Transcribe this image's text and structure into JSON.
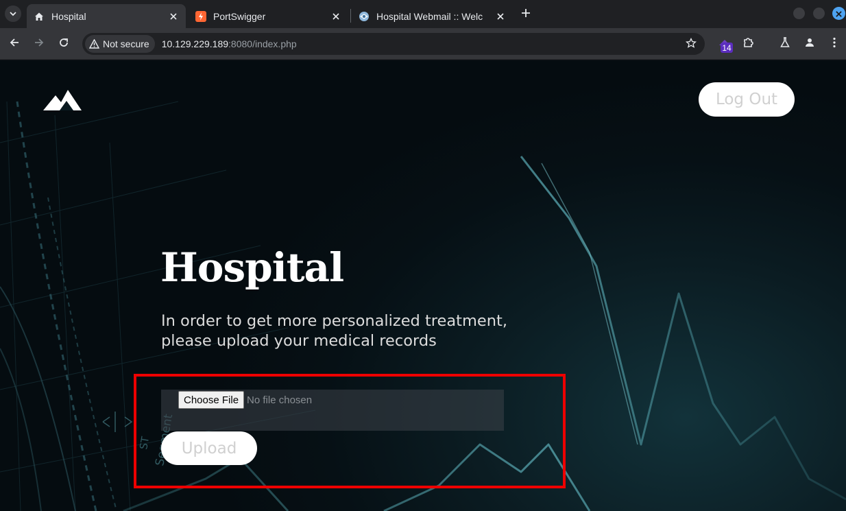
{
  "browser": {
    "tabs": [
      {
        "title": "Hospital",
        "favicon": "house-icon",
        "active": true
      },
      {
        "title": "PortSwigger",
        "favicon": "portswigger-icon",
        "active": false
      },
      {
        "title": "Hospital Webmail :: Welc",
        "favicon": "roundcube-icon",
        "active": false
      }
    ],
    "security_label": "Not secure",
    "url_host": "10.129.229.189",
    "url_rest": ":8080/index.php",
    "extension_badge": "14"
  },
  "page": {
    "logout_label": "Log Out",
    "title": "Hospital",
    "subtitle_line1": "In order to get more personalized treatment,",
    "subtitle_line2": "please upload your medical records",
    "file_input": {
      "button_label": "Choose File",
      "status": "No file chosen"
    },
    "upload_label": "Upload",
    "background_labels": [
      "Segment",
      "ST"
    ]
  },
  "colors": {
    "highlight": "#ee0000",
    "ecg_line": "#5fb3bd",
    "close_button": "#4ea3f1"
  }
}
